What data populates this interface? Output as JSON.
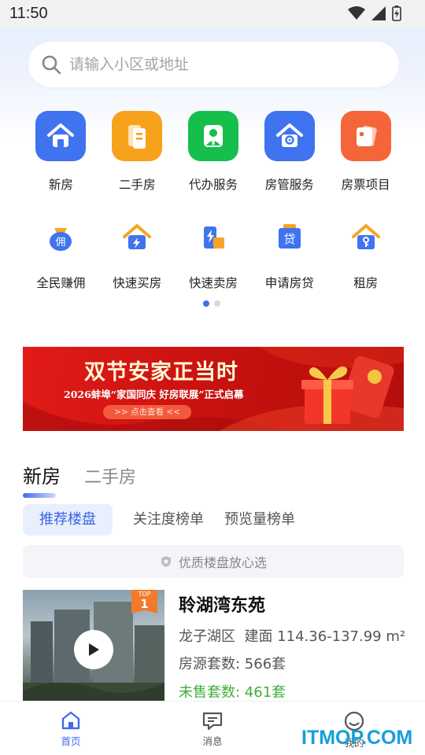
{
  "status_bar": {
    "time": "11:50"
  },
  "search": {
    "placeholder": "请输入小区或地址"
  },
  "services_row1": [
    {
      "label": "新房",
      "icon": "house-icon",
      "color": "#3f73ef"
    },
    {
      "label": "二手房",
      "icon": "document-icon",
      "color": "#f7a21b"
    },
    {
      "label": "代办服务",
      "icon": "agent-icon",
      "color": "#16be4c"
    },
    {
      "label": "房管服务",
      "icon": "house-gear-icon",
      "color": "#3f73ef"
    },
    {
      "label": "房票项目",
      "icon": "ticket-icon",
      "color": "#f4663a"
    }
  ],
  "services_row2": [
    {
      "label": "全民赚佣",
      "icon": "money-bag-icon"
    },
    {
      "label": "快速买房",
      "icon": "flash-house-icon"
    },
    {
      "label": "快速卖房",
      "icon": "flash-sell-icon"
    },
    {
      "label": "申请房贷",
      "icon": "loan-icon"
    },
    {
      "label": "租房",
      "icon": "key-house-icon"
    }
  ],
  "banner": {
    "title": "双节安家正当时",
    "subtitle": "2026蚌埠“家国同庆 好房联展”正式启幕",
    "button": ">> 点击查看 <<"
  },
  "tabs": {
    "active": "新房",
    "inactive": "二手房"
  },
  "subtabs": {
    "active": "推荐楼盘",
    "items": [
      "关注度榜单",
      "预览量榜单"
    ]
  },
  "notice": {
    "text": "优质楼盘放心选"
  },
  "listing": {
    "badge_top": "TOP",
    "badge_rank": "1",
    "title": "聆湖湾东苑",
    "district": "龙子湖区",
    "area": "建面 114.36-137.99 m²",
    "units": "房源套数: 566套",
    "unsold": "未售套数: 461套"
  },
  "bottom_nav": [
    {
      "label": "首页",
      "icon": "home-icon",
      "active": true
    },
    {
      "label": "消息",
      "icon": "message-icon",
      "active": false
    },
    {
      "label": "我的",
      "icon": "profile-icon",
      "active": false
    }
  ],
  "watermark": "ITMOP.COM",
  "colors": {
    "accent": "#3f6cf0",
    "text_dark": "#222222",
    "text_muted": "#888888",
    "green": "#3fae3a"
  }
}
